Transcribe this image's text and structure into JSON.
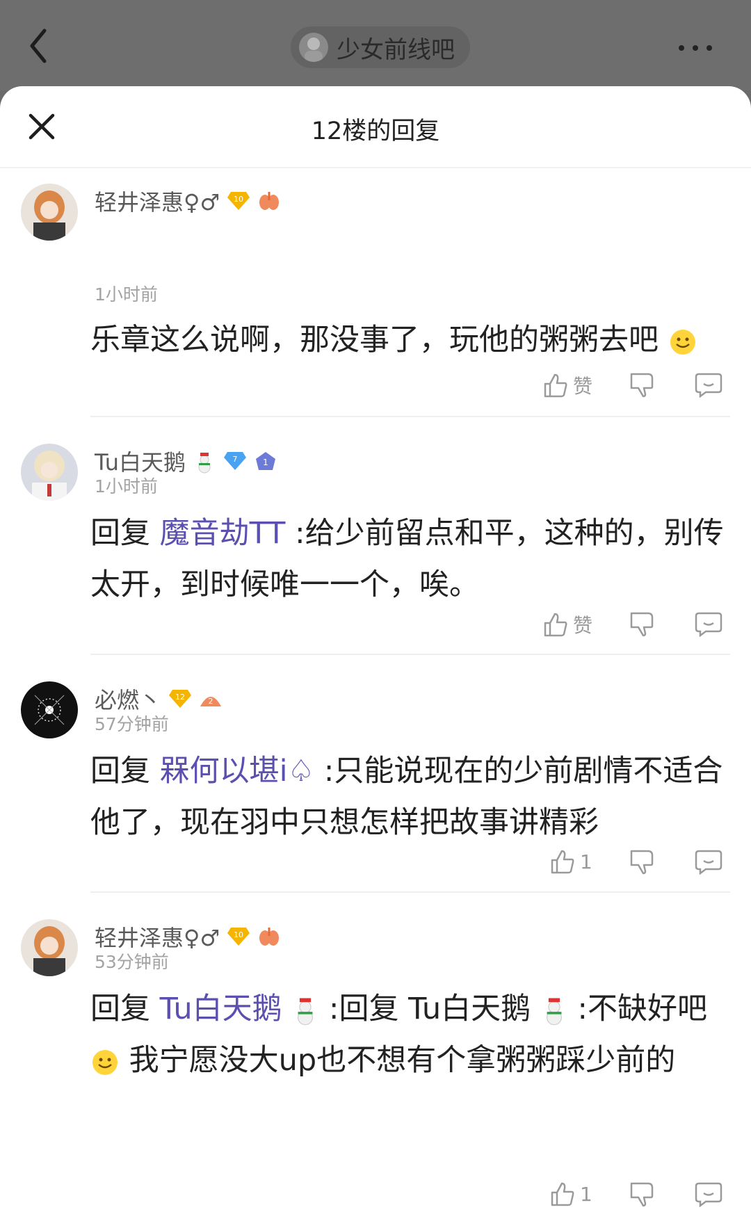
{
  "nav": {
    "forum_name": "少女前线吧"
  },
  "sheet": {
    "title": "12楼的回复"
  },
  "replies": [
    {
      "username": "轻井泽惠♀♂",
      "level_badge": "10",
      "time": "1小时前",
      "reply_prefix": "",
      "mention": "",
      "text": "乐章这么说啊，那没事了，玩他的粥粥去吧",
      "like_label": "赞"
    },
    {
      "username": "Tu白天鹅",
      "level_badge": "7",
      "rank_badge": "1",
      "time": "1小时前",
      "reply_prefix": "回复",
      "mention": "魔音劫TT",
      "text": ":给少前留点和平，这种的，别传太开，到时候唯一一个，唉。",
      "like_label": "赞"
    },
    {
      "username": "必燃丶",
      "level_badge": "12",
      "time": "57分钟前",
      "reply_prefix": "回复",
      "mention": "槑何以堪i♤",
      "text": ":只能说现在的少前剧情不适合他了，现在羽中只想怎样把故事讲精彩",
      "like_count": "1"
    },
    {
      "username": "轻井泽惠♀♂",
      "level_badge": "10",
      "time": "53分钟前",
      "reply_prefix": "回复",
      "mention": "Tu白天鹅",
      "text_a": ":回复 Tu白天鹅",
      "text_b": ":不缺好吧",
      "text_c": "我宁愿没大up也不想有个拿粥粥踩少前的",
      "like_count": "1"
    }
  ],
  "icons": {
    "back": "chevron-left-icon",
    "more": "more-dots-icon",
    "close": "close-icon",
    "like": "thumbs-up-icon",
    "dislike": "thumbs-down-icon",
    "comment": "comment-icon"
  },
  "colors": {
    "mention": "#5b4fb0",
    "badge_gold": "#f5b400",
    "badge_blue": "#4aa3f0"
  }
}
